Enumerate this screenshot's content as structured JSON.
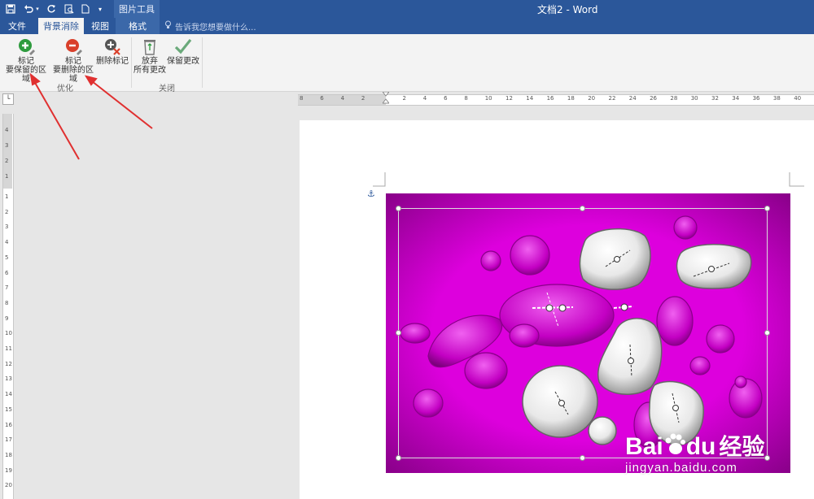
{
  "title_bar": {
    "doc_title": "文档2 - Word",
    "context_group": "图片工具"
  },
  "tabs": {
    "file": "文件",
    "background_removal": "背景消除",
    "view": "视图",
    "format": "格式",
    "tell_me": "告诉我您想要做什么..."
  },
  "ribbon": {
    "mark_keep_line1": "标记",
    "mark_keep_line2": "要保留的区域",
    "mark_remove_line1": "标记",
    "mark_remove_line2": "要删除的区域",
    "delete_mark": "删除标记",
    "discard_line1": "放弃",
    "discard_line2": "所有更改",
    "keep_changes": "保留更改",
    "group_refine": "优化",
    "group_close": "关闭"
  },
  "ruler": {
    "h_labels": [
      "8",
      "6",
      "4",
      "2",
      "",
      "2",
      "4",
      "6",
      "8",
      "10",
      "12",
      "14",
      "16",
      "18",
      "20",
      "22",
      "24",
      "26",
      "28",
      "30",
      "32",
      "34",
      "36",
      "38",
      "40"
    ],
    "v_labels": [
      "4",
      "3",
      "2",
      "1",
      "1",
      "2",
      "3",
      "4",
      "5",
      "6",
      "7",
      "8",
      "9",
      "10",
      "11",
      "12",
      "13",
      "14",
      "15",
      "16",
      "17",
      "18",
      "19",
      "20"
    ]
  },
  "watermark": {
    "brand_a": "Bai",
    "brand_b": "du",
    "brand_cn": "经验",
    "url": "jingyan.baidu.com"
  },
  "colors": {
    "title_bar": "#2b579a",
    "image_background": "#c300c3",
    "annotation_arrow": "#e03030"
  },
  "icons": {
    "save": "save-icon",
    "undo": "undo-icon",
    "redo": "redo-icon",
    "mark_keep": "plus-pencil-icon",
    "mark_remove": "minus-pencil-icon",
    "delete_mark": "delete-mark-icon",
    "discard": "recycle-bin-icon",
    "keep_changes": "checkmark-icon"
  }
}
